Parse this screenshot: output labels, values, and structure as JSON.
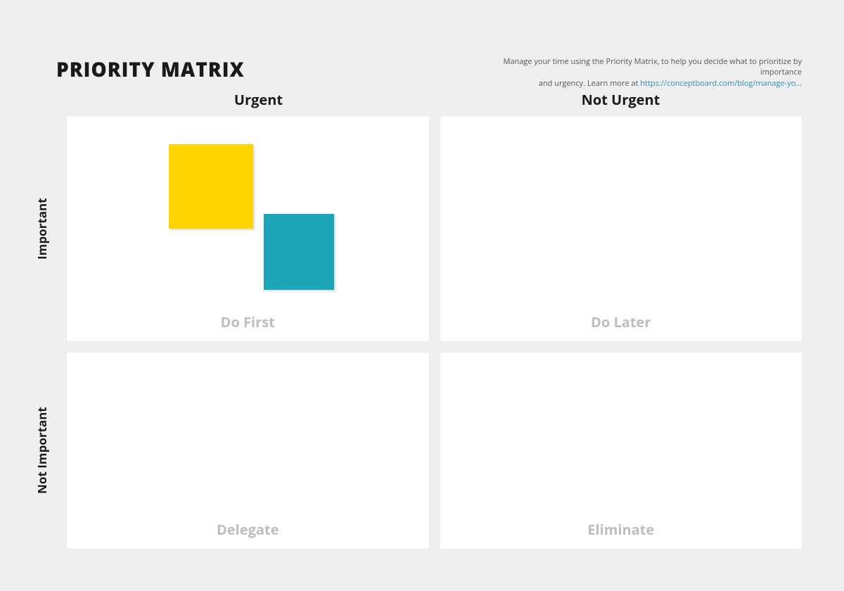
{
  "header": {
    "title": "PRIORITY MATRIX",
    "description_line1": "Manage your time using the Priority Matrix, to help you decide what to prioritize by importance",
    "description_line2": "and urgency. Learn more at ",
    "link_text": "https://conceptboard.com/blog/manage-yo..."
  },
  "columns": {
    "left": "Urgent",
    "right": "Not Urgent"
  },
  "rows": {
    "top": "Important",
    "bottom": "Not Important"
  },
  "quadrants": {
    "q1": "Do First",
    "q2": "Do Later",
    "q3": "Delegate",
    "q4": "Eliminate"
  },
  "stickies": {
    "yellow_color": "#ffd500",
    "teal_color": "#1ca6b7"
  }
}
